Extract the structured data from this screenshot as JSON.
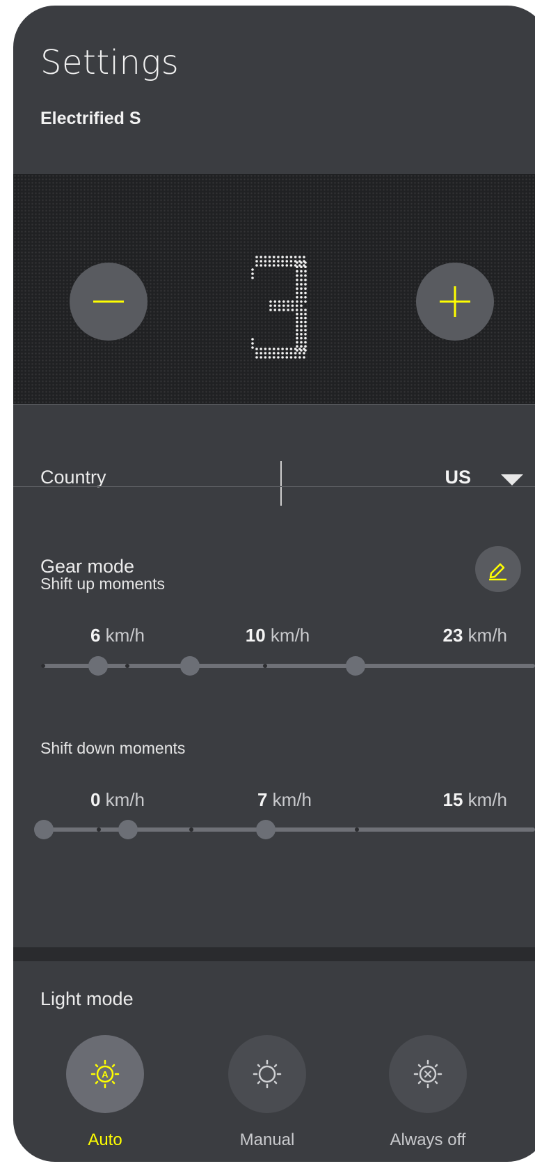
{
  "header": {
    "title": "Settings",
    "subtitle": "Electrified S"
  },
  "assist": {
    "level": "3",
    "decrease_icon": "minus-icon",
    "increase_icon": "plus-icon"
  },
  "country": {
    "label": "Country",
    "value": "US"
  },
  "gear_mode": {
    "label": "Gear mode",
    "edit_icon": "pencil-icon",
    "shift_up": {
      "label": "Shift up moments",
      "unit": "km/h",
      "values": [
        "6",
        "10",
        "23"
      ]
    },
    "shift_down": {
      "label": "Shift down moments",
      "unit": "km/h",
      "values": [
        "0",
        "7",
        "15"
      ]
    }
  },
  "light_mode": {
    "label": "Light mode",
    "options": [
      {
        "label": "Auto",
        "icon": "auto-light-icon",
        "selected": true
      },
      {
        "label": "Manual",
        "icon": "sun-icon",
        "selected": false
      },
      {
        "label": "Always off",
        "icon": "light-off-icon",
        "selected": false
      }
    ]
  },
  "colors": {
    "accent": "#ffff00",
    "panel": "#3b3d41",
    "dial_bg": "#202123"
  }
}
